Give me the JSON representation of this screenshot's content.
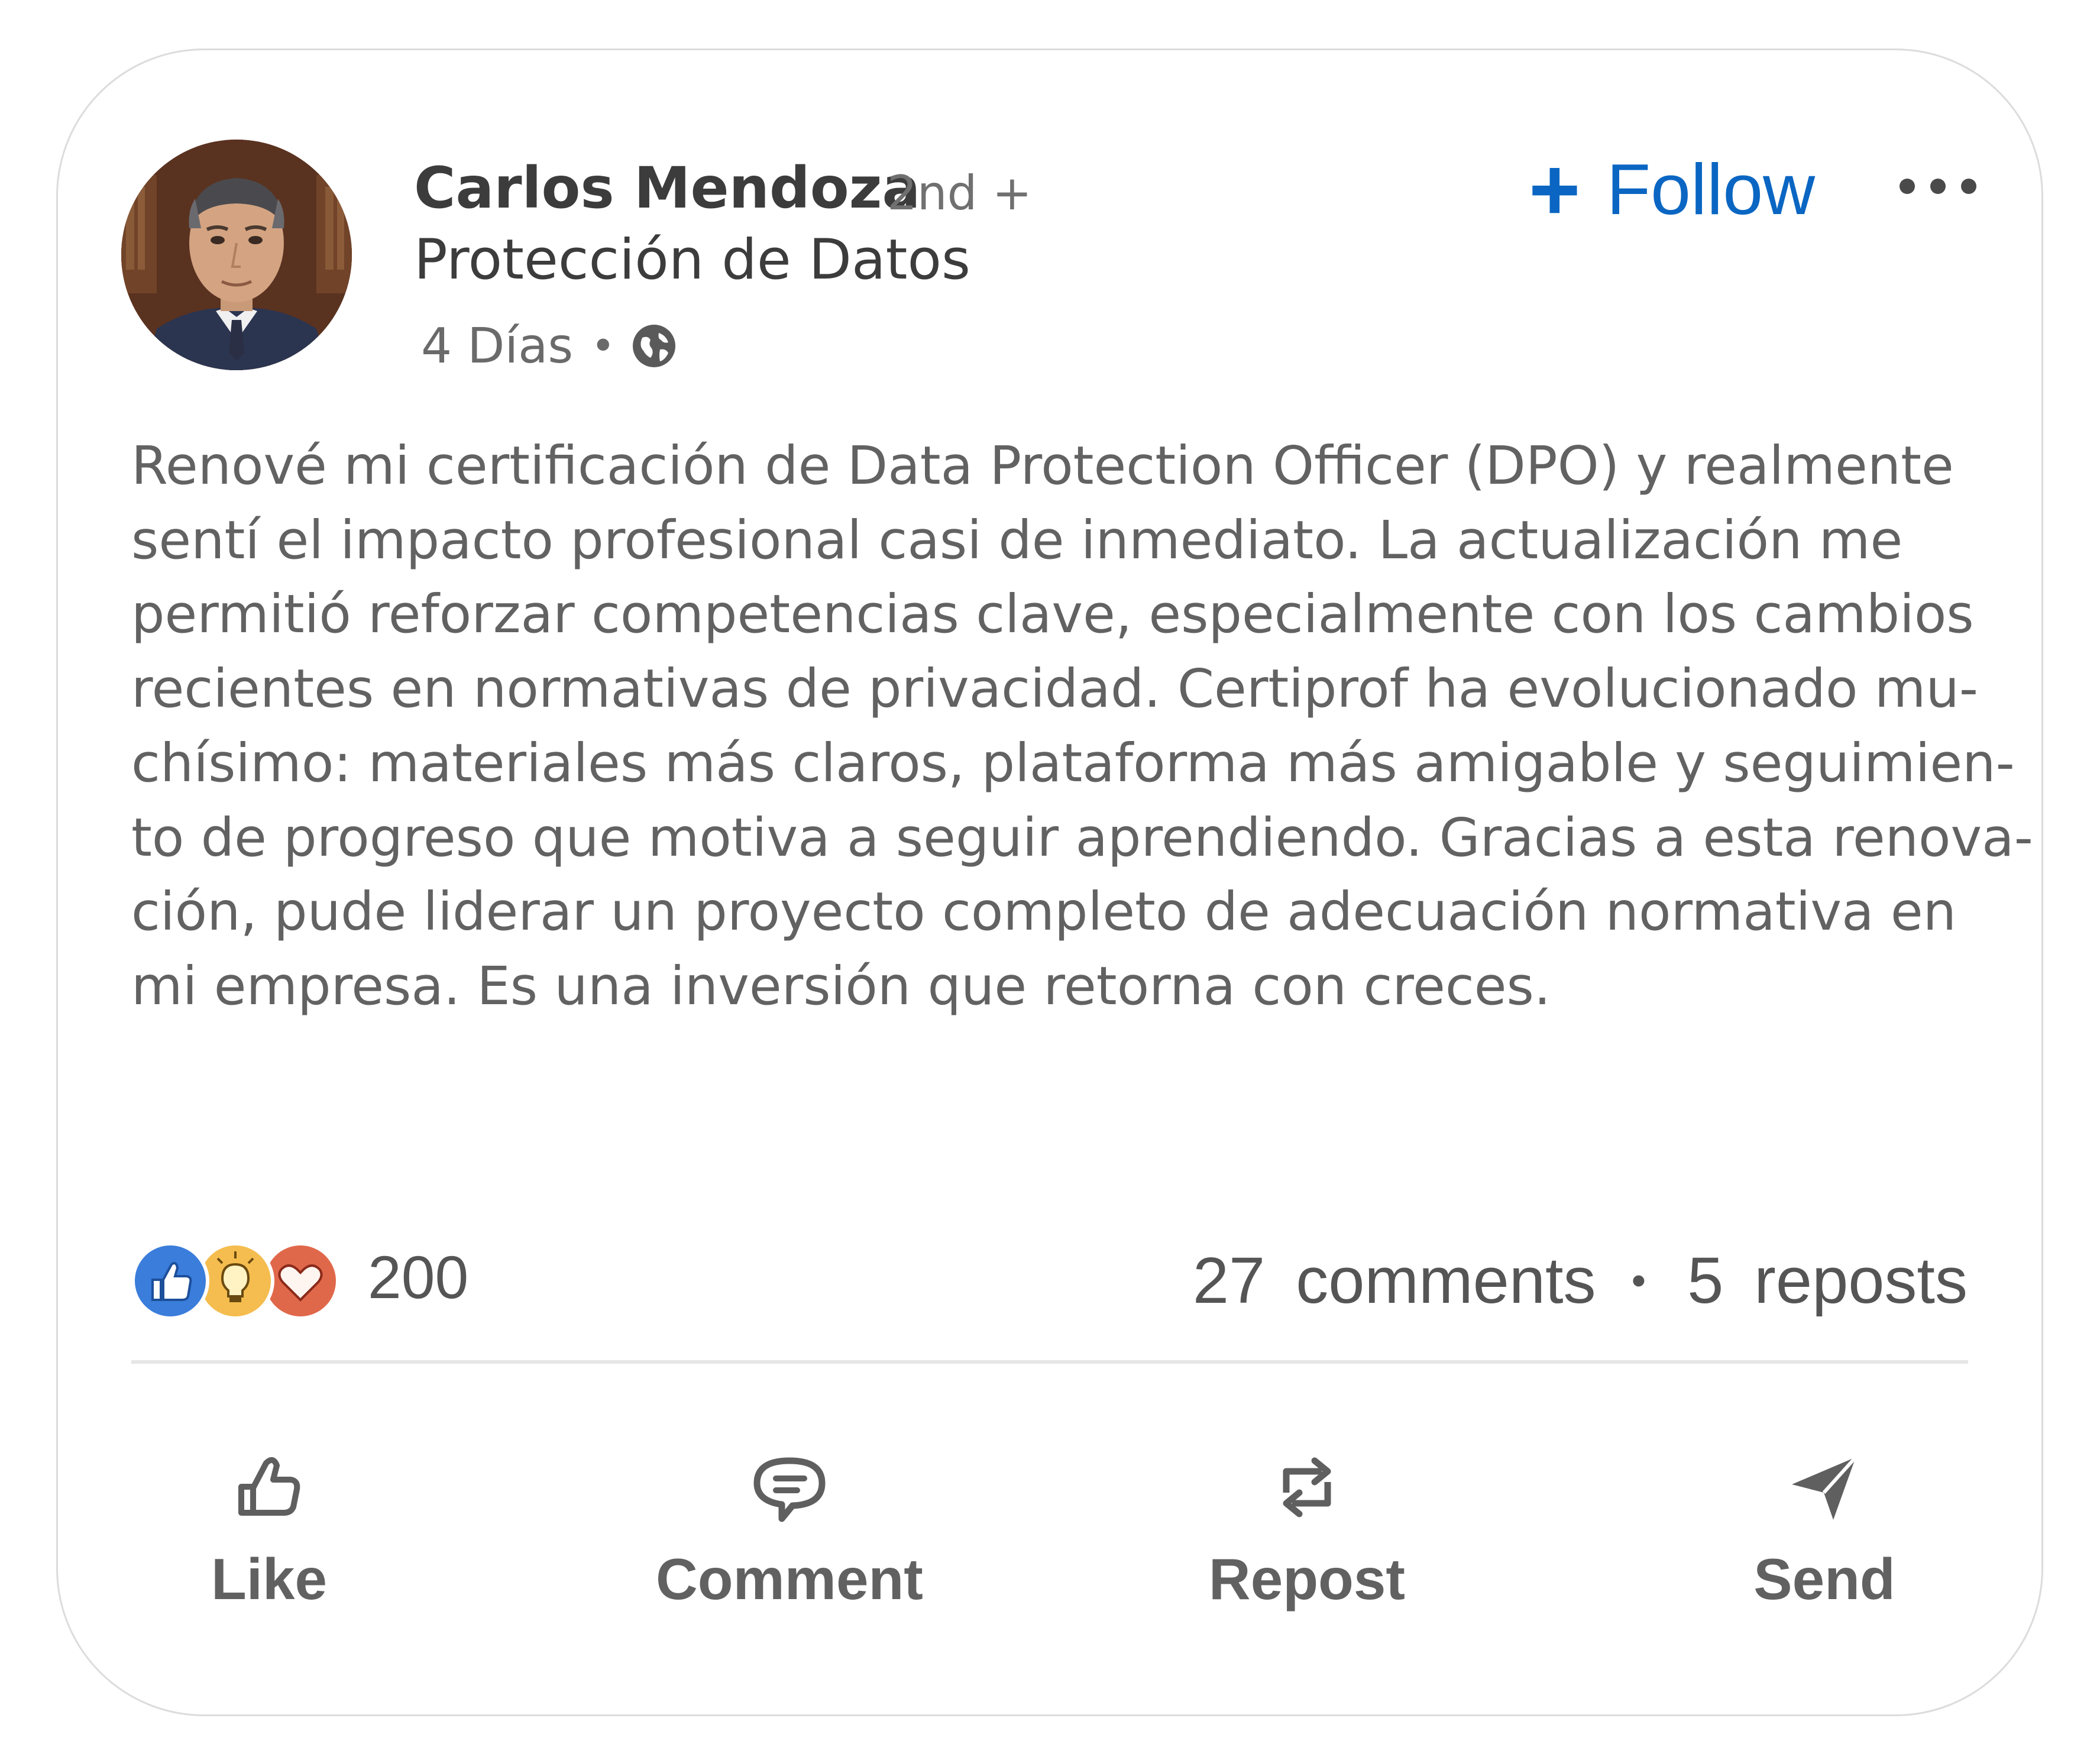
{
  "post": {
    "author": {
      "name": "Carlos Mendoza",
      "connection_degree": "2nd +",
      "headline": "Protección de Datos",
      "posted_ago": "4 Días",
      "meta_separator": "•",
      "visibility_icon": "globe-icon"
    },
    "follow_label": "Follow",
    "follow_icon": "plus-icon",
    "more_icon": "more-options-icon",
    "body_lines": [
      "Renové mi certificación de Data Protection Officer (DPO) y realmente",
      "sentí el impacto profesional casi de inmediato. La actualización me",
      "permitió reforzar competencias clave, especialmente con los cambios",
      "recientes en normativas de privacidad. Certiprof ha evolucionado mu-",
      "chísimo: materiales más claros, plataforma más amigable y seguimien-",
      "to de progreso que motiva a seguir aprendiendo. Gracias a esta renova-",
      "ción, pude liderar un proyecto completo de adecuación normativa en",
      "mi empresa. Es una inversión que retorna con creces."
    ],
    "reactions": {
      "icons": [
        "like-reaction-icon",
        "insightful-reaction-icon",
        "love-reaction-icon"
      ],
      "count": "200"
    },
    "social": {
      "comments_count": "27",
      "comments_label": "comments",
      "separator": "•",
      "reposts_count": "5",
      "reposts_label": "reposts"
    },
    "actions": {
      "like": "Like",
      "comment": "Comment",
      "repost": "Repost",
      "send": "Send"
    },
    "colors": {
      "accent": "#0a66c2",
      "like_reaction": "#3a7ddb",
      "insightful_reaction": "#f5bd4f",
      "love_reaction": "#e0684a",
      "text_primary": "#3c3c3c",
      "text_secondary": "#626262"
    }
  }
}
